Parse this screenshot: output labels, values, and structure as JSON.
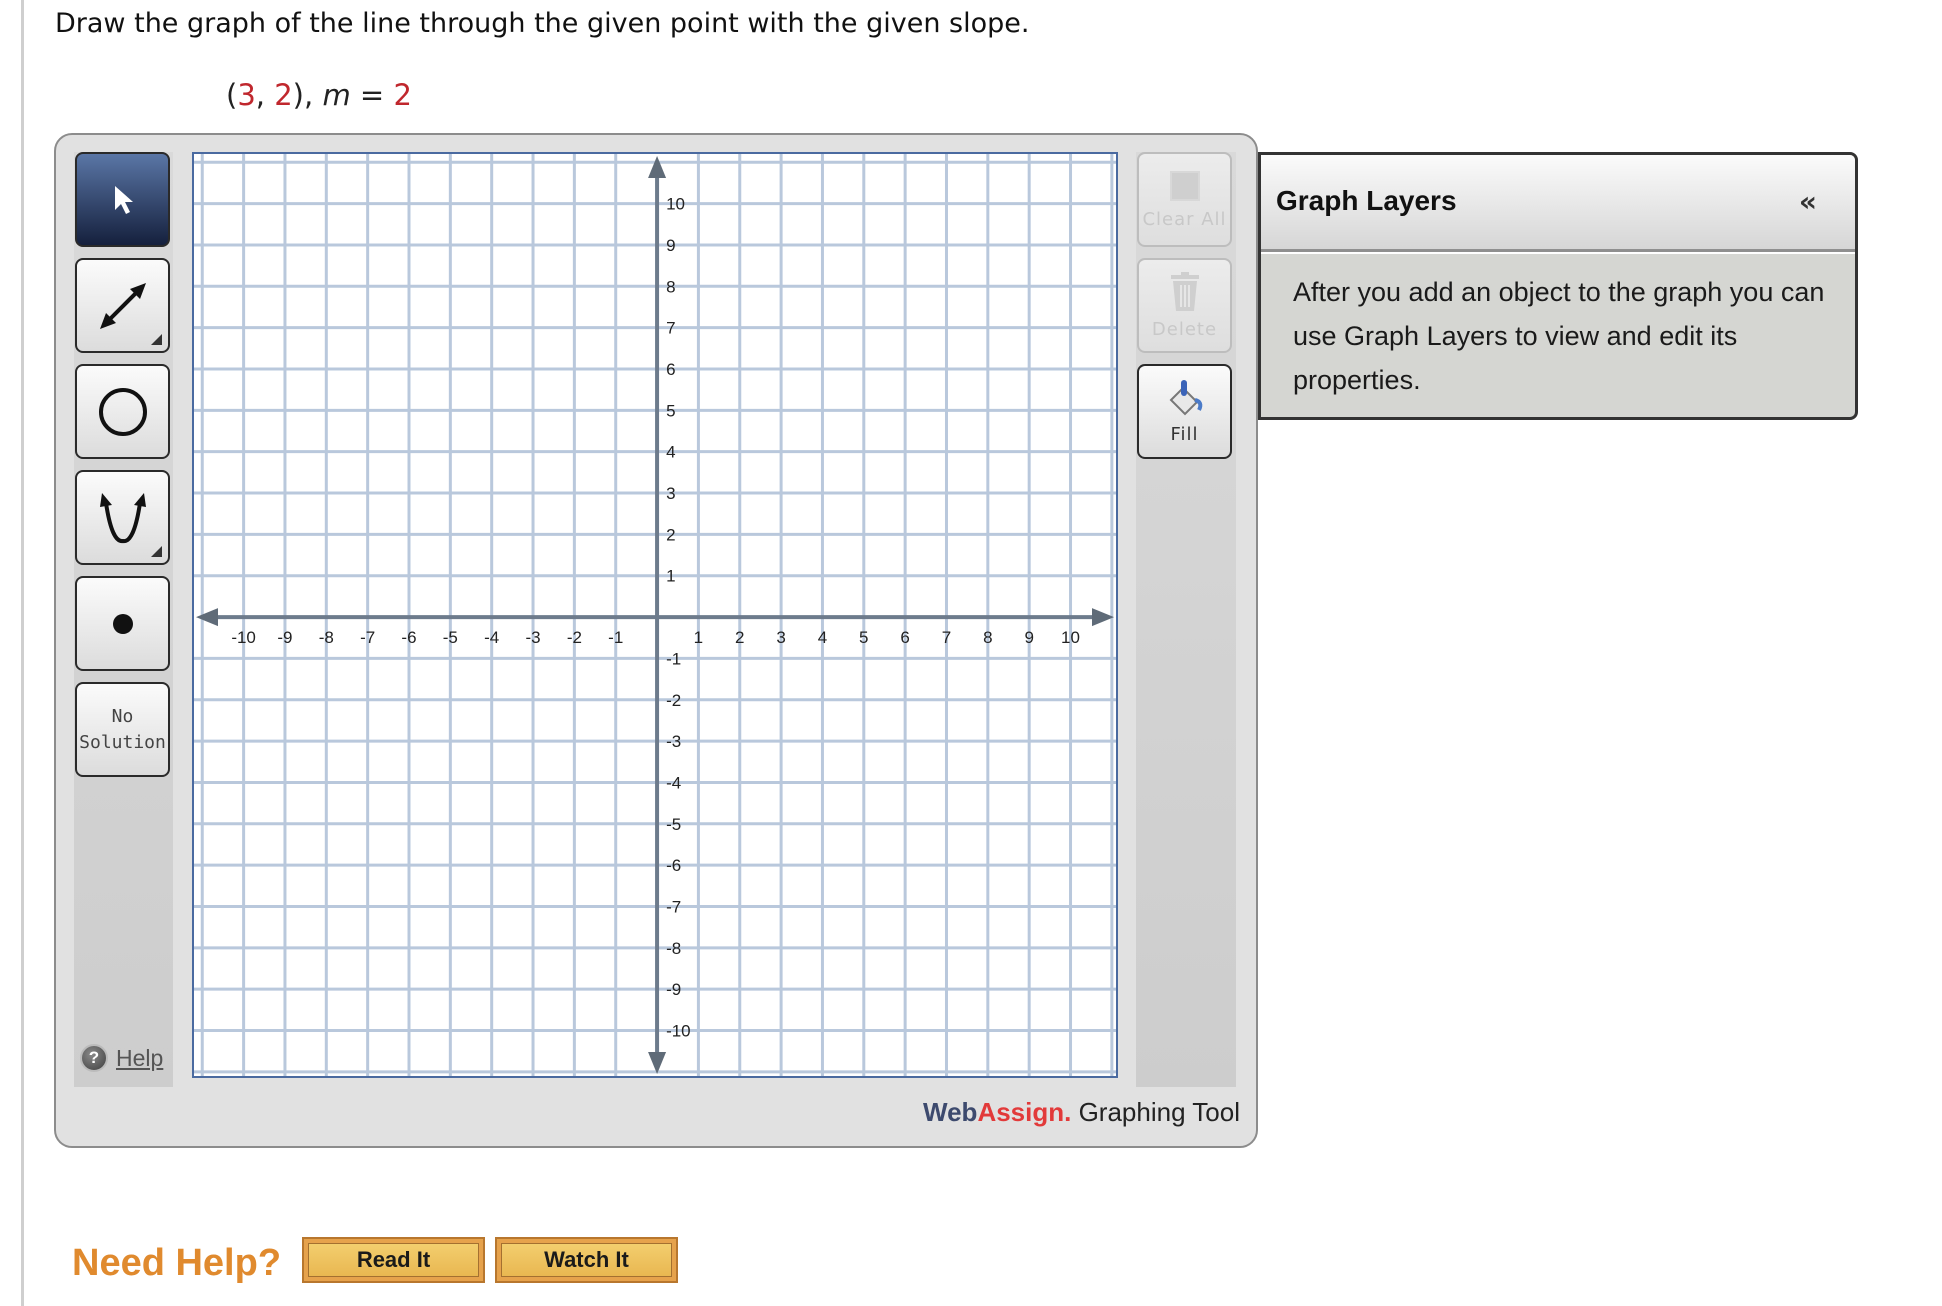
{
  "question": {
    "prompt": "Draw the graph of the line through the given point with the given slope.",
    "point_open": "(",
    "point_x": "3",
    "point_sep": ", ",
    "point_y": "2",
    "point_close": "),",
    "slope_var": "m",
    "slope_eq": " = ",
    "slope_value": "2"
  },
  "toolbar": {
    "tools": [
      {
        "name": "select",
        "icon": "pointer-arrow-icon",
        "active": true
      },
      {
        "name": "line",
        "icon": "double-arrow-line-icon",
        "has_submenu": true
      },
      {
        "name": "circle",
        "icon": "circle-icon"
      },
      {
        "name": "parabola",
        "icon": "parabola-icon",
        "has_submenu": true
      },
      {
        "name": "point",
        "icon": "point-dot-icon"
      },
      {
        "name": "no-solution",
        "label_line1": "No",
        "label_line2": "Solution"
      }
    ],
    "help_label": "Help"
  },
  "actions": {
    "clear_all_label": "Clear All",
    "delete_label": "Delete",
    "fill_label": "Fill"
  },
  "graph": {
    "x_ticks": [
      "-10",
      "-9",
      "-8",
      "-7",
      "-6",
      "-5",
      "-4",
      "-3",
      "-2",
      "-1",
      "1",
      "2",
      "3",
      "4",
      "5",
      "6",
      "7",
      "8",
      "9",
      "10"
    ],
    "y_ticks": [
      "10",
      "9",
      "8",
      "7",
      "6",
      "5",
      "4",
      "3",
      "2",
      "1",
      "-1",
      "-2",
      "-3",
      "-4",
      "-5",
      "-6",
      "-7",
      "-8",
      "-9",
      "-10"
    ],
    "x_range": [
      -11.2,
      11.1
    ],
    "y_range": [
      -11.1,
      11.2
    ],
    "grid_step": 1
  },
  "branding": {
    "web": "Web",
    "assign": "Assign.",
    "tool": " Graphing Tool"
  },
  "layers_panel": {
    "title": "Graph Layers",
    "collapse_glyph": "«",
    "body": "After you add an object to the graph you can use Graph Layers to view and edit its properties."
  },
  "need_help": {
    "label": "Need Help?",
    "read_it": "Read It",
    "watch_it": "Watch It"
  }
}
